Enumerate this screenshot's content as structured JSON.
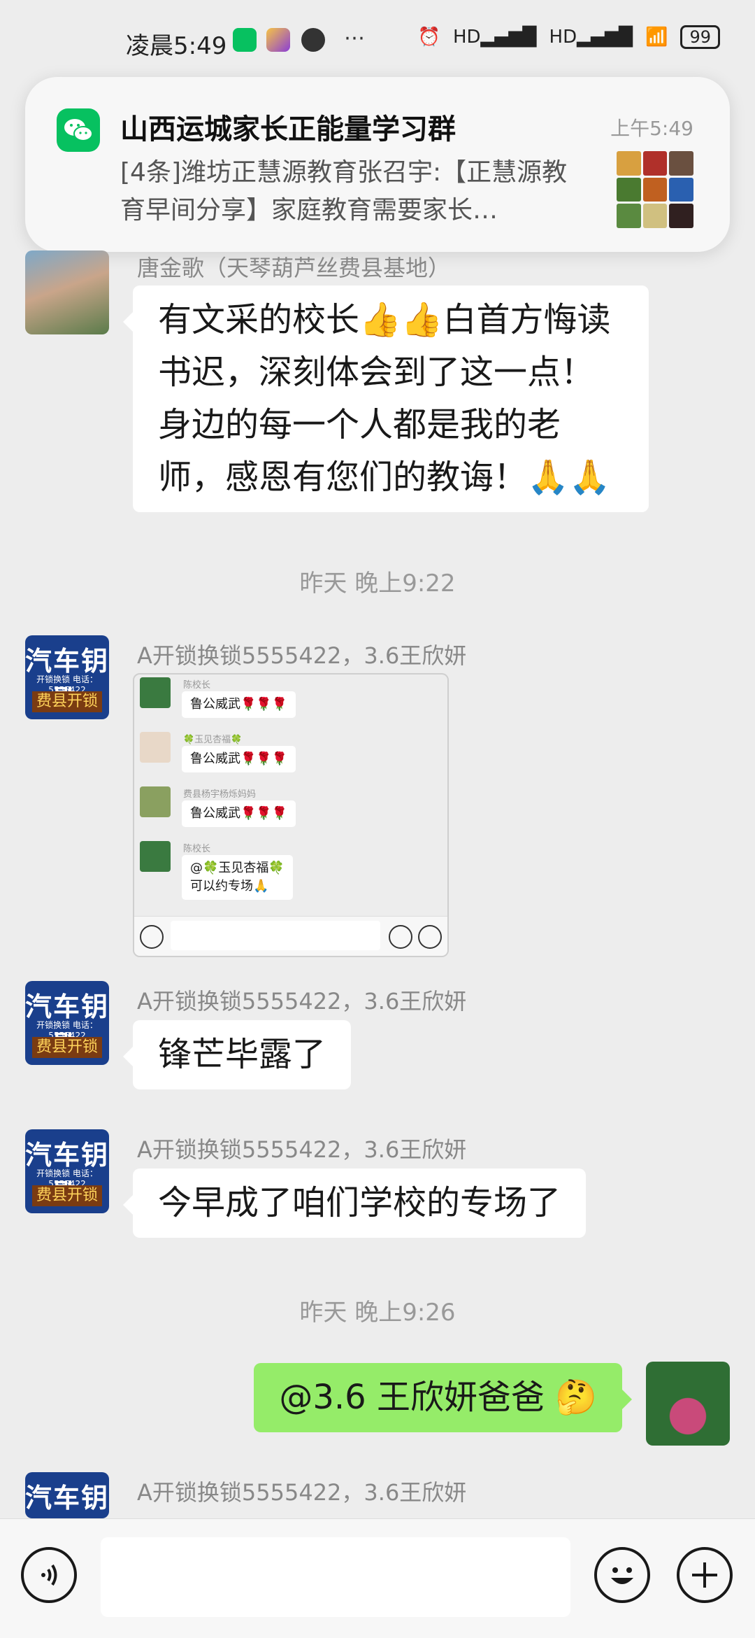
{
  "status_bar": {
    "time": "凌晨5:49",
    "battery": "99",
    "signal_1": "HD",
    "signal_2": "HD",
    "wifi_label": "6"
  },
  "notification": {
    "title": "山西运城家长正能量学习群",
    "time": "上午5:49",
    "body": "[4条]潍坊正慧源教育张召宇:【正慧源教育早间分享】家庭教育需要家长…"
  },
  "messages": [
    {
      "sender": "唐金歌（天琴葫芦丝费县基地）",
      "text": "有文采的校长👍👍白首方悔读书迟，深刻体会到了这一点！身边的每一个人都是我的老师，感恩有您们的教诲！🙏🙏"
    },
    {
      "timestamp": "昨天 晚上9:22"
    },
    {
      "sender": "A开锁换锁5555422，3.6王欣妍",
      "screenshot": [
        {
          "name": "陈校长",
          "text": "鲁公威武🌹🌹🌹"
        },
        {
          "name": "🍀玉见杏福🍀",
          "text": "鲁公威武🌹🌹🌹"
        },
        {
          "name": "费县杨宇杨烁妈妈",
          "text": "鲁公威武🌹🌹🌹"
        },
        {
          "name": "陈校长",
          "text": "@🍀玉见杏福🍀",
          "text2": "可以约专场🙏"
        }
      ]
    },
    {
      "sender": "A开锁换锁5555422，3.6王欣妍",
      "text": "锋芒毕露了"
    },
    {
      "sender": "A开锁换锁5555422，3.6王欣妍",
      "text": "今早成了咱们学校的专场了"
    },
    {
      "timestamp": "昨天 晚上9:26"
    },
    {
      "self": true,
      "text": "@3.6 王欣妍爸爸 🤔"
    },
    {
      "sender": "A开锁换锁5555422，3.6王欣妍"
    }
  ],
  "avatar_lock": {
    "line1": "汽车钥匙",
    "line2": "开锁换锁 电话：5555422",
    "line3": "费县开锁"
  },
  "colors": {
    "bg": "#ededed",
    "self_bubble": "#95ec69",
    "wechat_green": "#07c160"
  },
  "icons": {
    "voice": "voice-icon",
    "emoji": "emoji-icon",
    "plus": "plus-icon",
    "wechat": "wechat-icon"
  }
}
